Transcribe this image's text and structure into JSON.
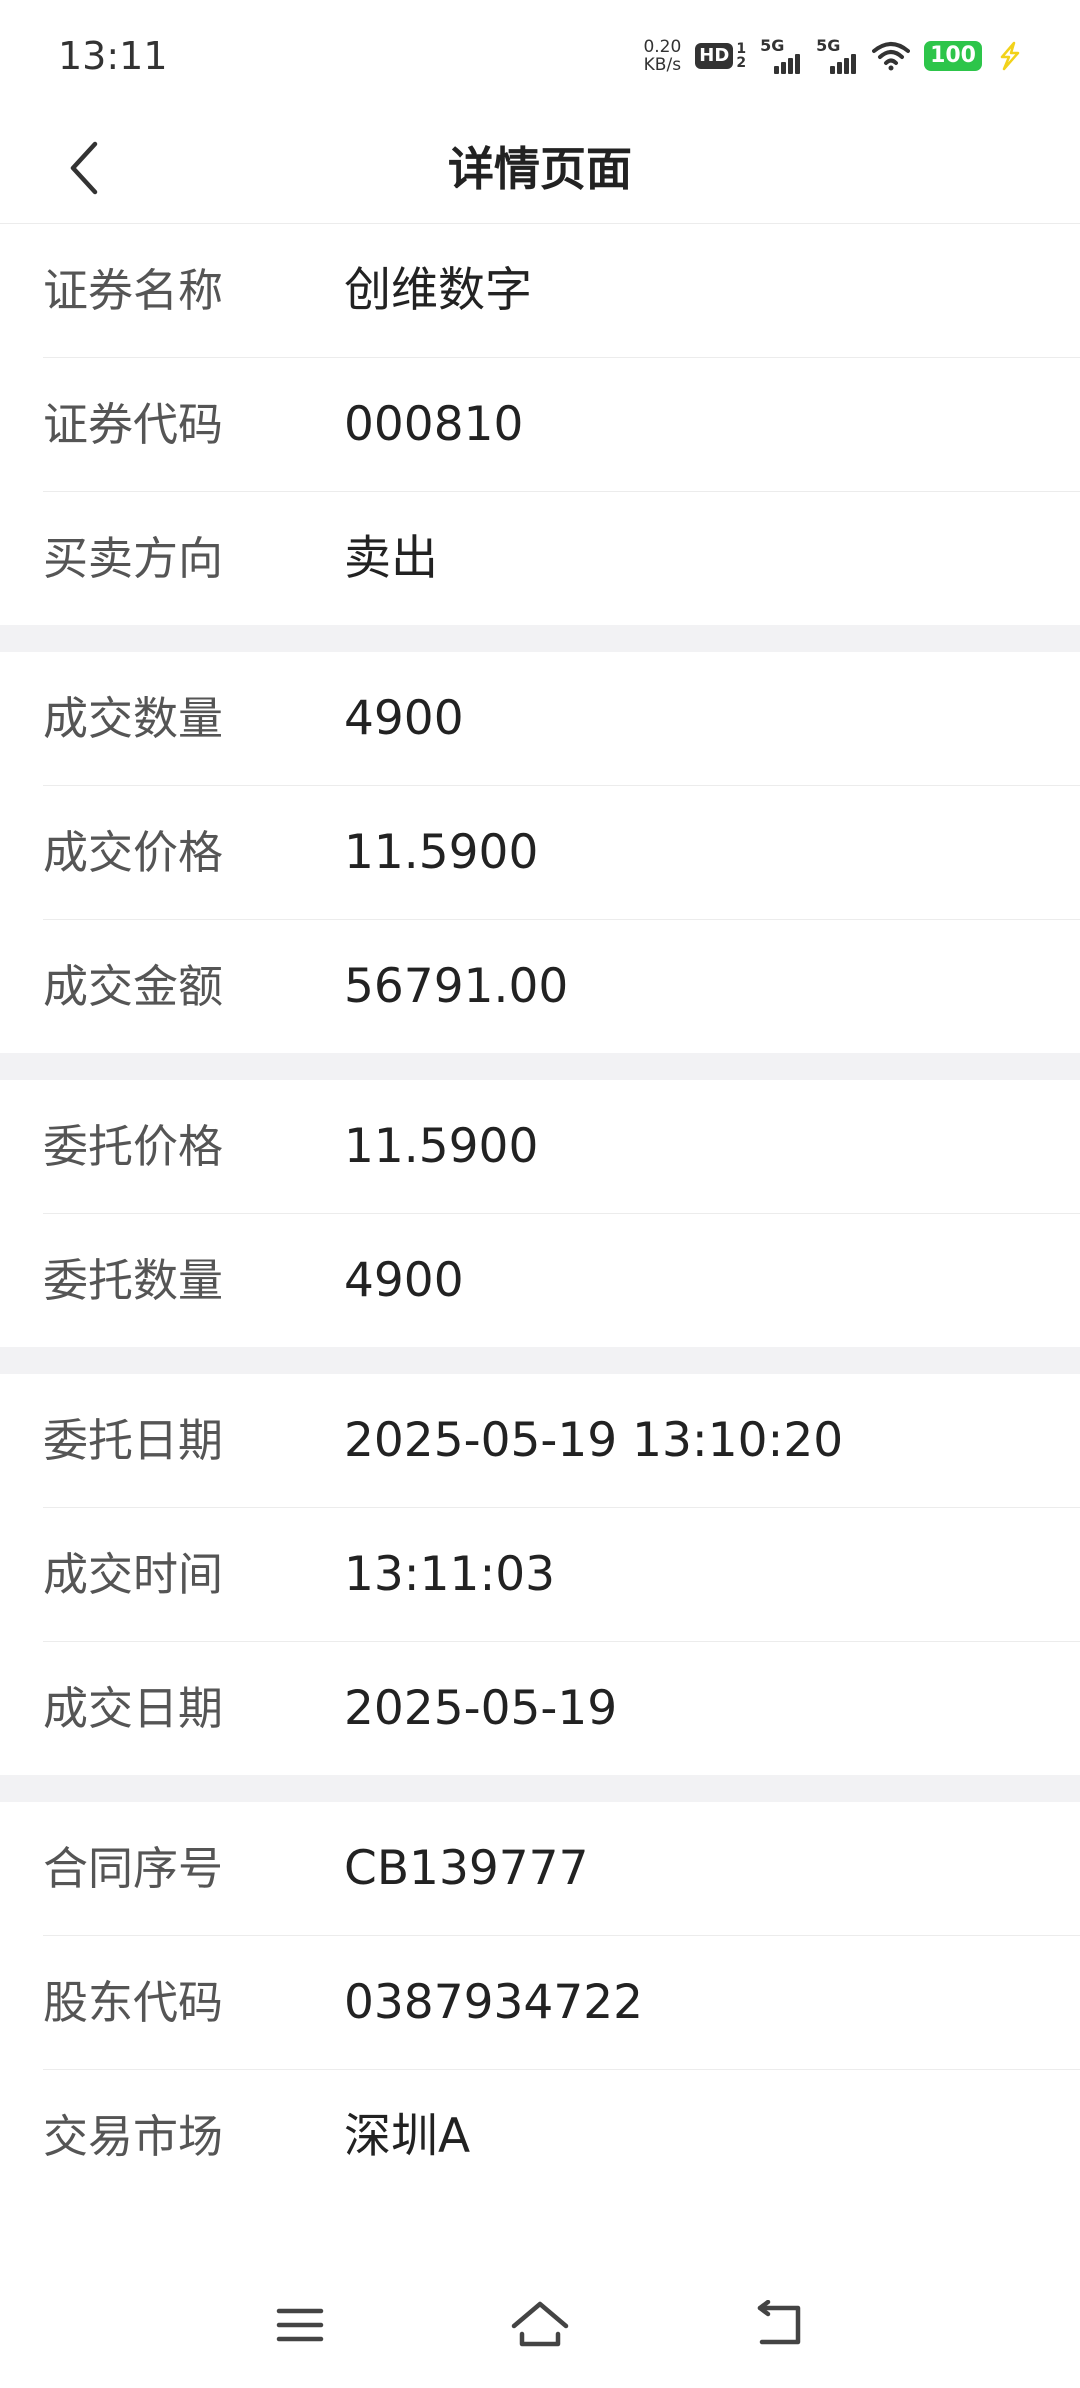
{
  "status_bar": {
    "time": "13:11",
    "net_speed_value": "0.20",
    "net_speed_unit": "KB/s",
    "hd_label": "HD",
    "hd_sub_top": "1",
    "hd_sub_bottom": "2",
    "sim1_label": "5G",
    "sim2_label": "5G",
    "battery_level": "100",
    "battery_color": "#2dc54a",
    "charging_color": "#f2d21b"
  },
  "header": {
    "title": "详情页面"
  },
  "groups": [
    {
      "rows": [
        {
          "label": "证券名称",
          "value": "创维数字"
        },
        {
          "label": "证券代码",
          "value": "000810"
        },
        {
          "label": "买卖方向",
          "value": "卖出"
        }
      ]
    },
    {
      "rows": [
        {
          "label": "成交数量",
          "value": "4900"
        },
        {
          "label": "成交价格",
          "value": "11.5900"
        },
        {
          "label": "成交金额",
          "value": "56791.00"
        }
      ]
    },
    {
      "rows": [
        {
          "label": "委托价格",
          "value": "11.5900"
        },
        {
          "label": "委托数量",
          "value": "4900"
        }
      ]
    },
    {
      "rows": [
        {
          "label": "委托日期",
          "value": "2025-05-19 13:10:20"
        },
        {
          "label": "成交时间",
          "value": "13:11:03"
        },
        {
          "label": "成交日期",
          "value": "2025-05-19"
        }
      ]
    },
    {
      "rows": [
        {
          "label": "合同序号",
          "value": "CB139777"
        },
        {
          "label": "股东代码",
          "value": "0387934722"
        },
        {
          "label": "交易市场",
          "value": "深圳A"
        }
      ]
    }
  ],
  "nav_bar": {
    "icons": [
      "menu-icon",
      "home-icon",
      "back-icon"
    ]
  }
}
